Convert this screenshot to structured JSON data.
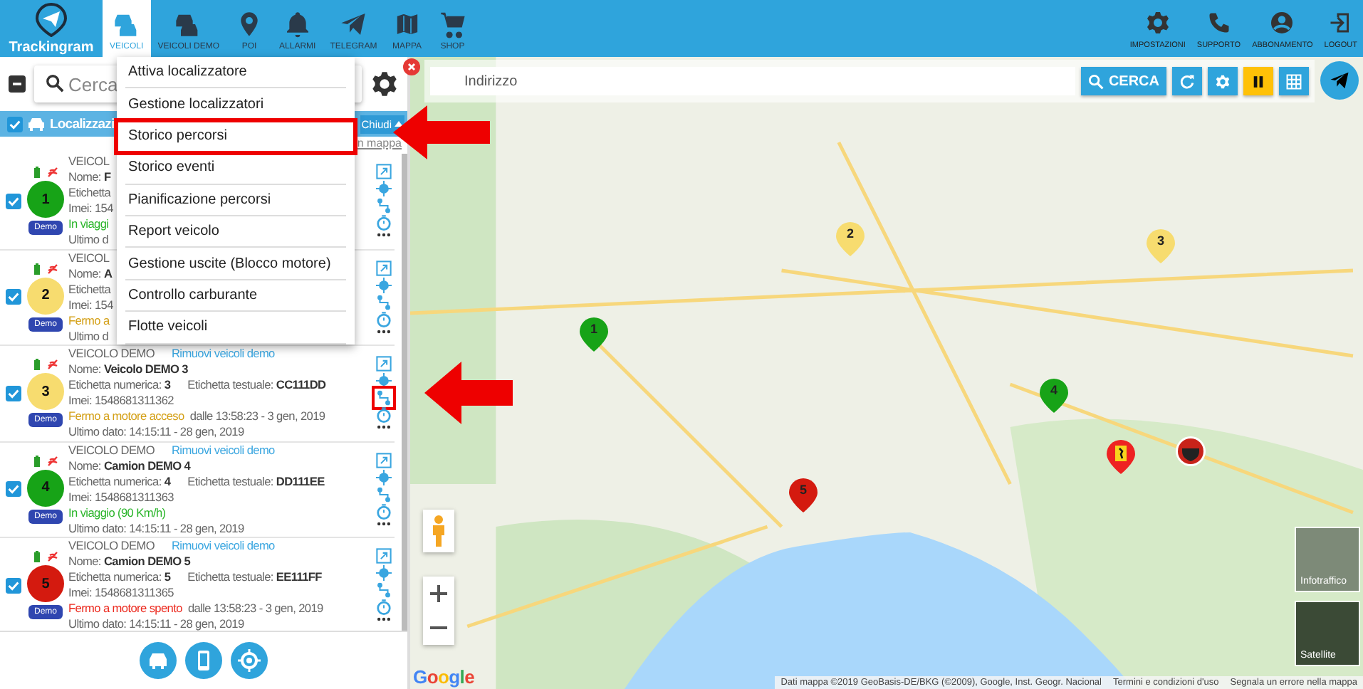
{
  "header": {
    "logo": "Trackingram",
    "tabs": [
      {
        "label": "VEICOLI",
        "selected": true
      },
      {
        "label": "VEICOLI DEMO",
        "selected": false
      },
      {
        "label": "POI",
        "selected": false
      },
      {
        "label": "ALLARMI",
        "selected": false
      },
      {
        "label": "TELEGRAM",
        "selected": false
      },
      {
        "label": "MAPPA",
        "selected": false
      },
      {
        "label": "SHOP",
        "selected": false
      }
    ],
    "actions": [
      "IMPOSTAZIONI",
      "SUPPORTO",
      "ABBONAMENTO",
      "LOGOUT"
    ]
  },
  "sidebar": {
    "select_all": {
      "indeterminate": true
    },
    "search": {
      "placeholder": "Cerca"
    },
    "group": {
      "title": "Localizzazi",
      "checked": true,
      "button": "Chiudi",
      "link": "n mappa"
    },
    "vehicles": [
      {
        "checked": true,
        "number": "1",
        "color": "#17a317",
        "badge": "Demo",
        "header": "VEICOL",
        "name": "Nome: **F**",
        "labels": [
          "Etichetta"
        ],
        "imei": "Imei: 154",
        "status": {
          "text": "In viaggi",
          "color": "#2bb52b"
        },
        "last": "Ultimo d",
        "route_highlighted": false
      },
      {
        "checked": true,
        "number": "2",
        "color": "#f7dc6f",
        "badge": "Demo",
        "header": "VEICOL",
        "name": "Nome: **A**",
        "labels": [
          "Etichetta"
        ],
        "imei": "Imei: 154",
        "status": {
          "text": "Fermo a",
          "color": "#d4a017"
        },
        "last": "Ultimo d",
        "route_highlighted": false
      },
      {
        "checked": true,
        "number": "3",
        "color": "#f7dc6f",
        "badge": "Demo",
        "header": "VEICOLO DEMO",
        "link": "Rimuovi veicoli demo",
        "name": "Nome: **Veicolo DEMO 3**",
        "labels": [
          "Etichetta numerica: **3**",
          "Etichetta testuale: **CC111DD**"
        ],
        "imei": "Imei: 1548681311362",
        "status": {
          "text": "Fermo a motore acceso",
          "color": "#d4a017",
          "detail": "dalle 13:58:23 - 3 gen, 2019"
        },
        "last": "Ultimo dato: 14:15:11 - 28 gen, 2019",
        "route_highlighted": true
      },
      {
        "checked": true,
        "number": "4",
        "color": "#17a317",
        "badge": "Demo",
        "header": "VEICOLO DEMO",
        "link": "Rimuovi veicoli demo",
        "name": "Nome: **Camion DEMO 4**",
        "labels": [
          "Etichetta numerica: **4**",
          "Etichetta testuale: **DD111EE**"
        ],
        "imei": "Imei: 1548681311363",
        "status": {
          "text": "In viaggio (90 Km/h)",
          "color": "#2bb52b"
        },
        "last": "Ultimo dato: 14:15:11 - 28 gen, 2019",
        "route_highlighted": false
      },
      {
        "checked": true,
        "number": "5",
        "color": "#d41a0f",
        "badge": "Demo",
        "header": "VEICOLO DEMO",
        "link": "Rimuovi veicoli demo",
        "name": "Nome: **Camion DEMO 5**",
        "labels": [
          "Etichetta numerica: **5**",
          "Etichetta testuale: **EE111FF**"
        ],
        "imei": "Imei: 1548681311365",
        "status": {
          "text": "Fermo a motore spento",
          "color": "#ec2a1f",
          "detail": "dalle 13:58:23 - 3 gen, 2019"
        },
        "last": "Ultimo dato: 14:15:11 - 28 gen, 2019",
        "route_highlighted": false
      }
    ]
  },
  "menu": {
    "items": [
      {
        "label": "Attiva localizzatore",
        "highlighted": false
      },
      {
        "label": "Gestione localizzatori",
        "highlighted": false
      },
      {
        "label": "Storico percorsi",
        "highlighted": true
      },
      {
        "label": "Storico eventi",
        "highlighted": false
      },
      {
        "label": "Pianificazione percorsi",
        "highlighted": false
      },
      {
        "label": "Report veicolo",
        "highlighted": false
      },
      {
        "label": "Gestione uscite (Blocco motore)",
        "highlighted": false
      },
      {
        "label": "Controllo carburante",
        "highlighted": false
      },
      {
        "label": "Flotte veicoli",
        "highlighted": false
      }
    ]
  },
  "map": {
    "address": {
      "placeholder": "Indirizzo"
    },
    "search_button": "CERCA",
    "paused": true,
    "markers": [
      {
        "label": "1",
        "color": "#17a317"
      },
      {
        "label": "2",
        "color": "#f7dc6f"
      },
      {
        "label": "3",
        "color": "#f7dc6f"
      },
      {
        "label": "4",
        "color": "#17a317"
      },
      {
        "label": "5",
        "color": "#d41a0f"
      }
    ],
    "layers": [
      "Infotraffico",
      "Satellite"
    ],
    "logo": "Google",
    "attribution": [
      "Dati mappa ©2019 GeoBasis-DE/BKG (©2009), Google, Inst. Geogr. Nacional",
      "Termini e condizioni d'uso",
      "Segnala un errore nella mappa"
    ]
  }
}
